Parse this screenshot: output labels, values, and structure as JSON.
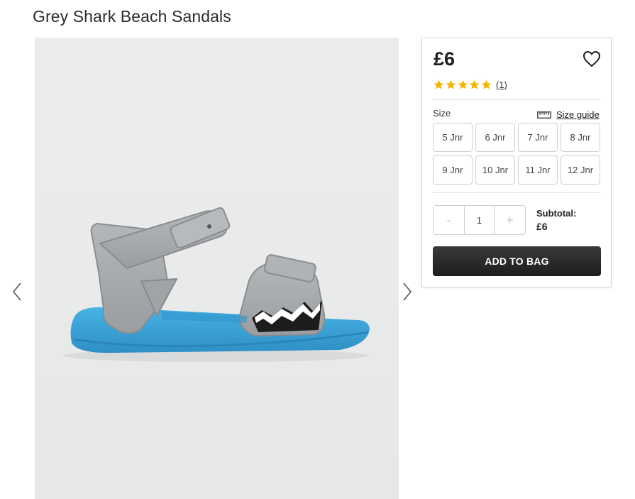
{
  "product": {
    "title": "Grey Shark Beach Sandals",
    "image_alt": "Grey shark beach sandal with blue sole"
  },
  "gallery": {
    "prev_icon": "chevron-left-icon",
    "next_icon": "chevron-right-icon"
  },
  "purchase": {
    "price": "£6",
    "wishlist_icon": "heart-icon",
    "rating": {
      "stars": 5,
      "max": 5,
      "review_count_label": "(1)",
      "star_color": "#f5b400"
    },
    "size": {
      "label": "Size",
      "guide_label": "Size guide",
      "guide_icon": "ruler-icon",
      "options": [
        "5 Jnr",
        "6 Jnr",
        "7 Jnr",
        "8 Jnr",
        "9 Jnr",
        "10 Jnr",
        "11 Jnr",
        "12 Jnr"
      ]
    },
    "quantity": {
      "minus": "-",
      "value": "1",
      "plus": "+"
    },
    "subtotal": {
      "label": "Subtotal:",
      "value": "£6"
    },
    "add_to_bag": "ADD TO BAG"
  },
  "colors": {
    "button_bg": "#232323",
    "sole_blue": "#3aa7dc",
    "strap_grey": "#a9acae"
  }
}
